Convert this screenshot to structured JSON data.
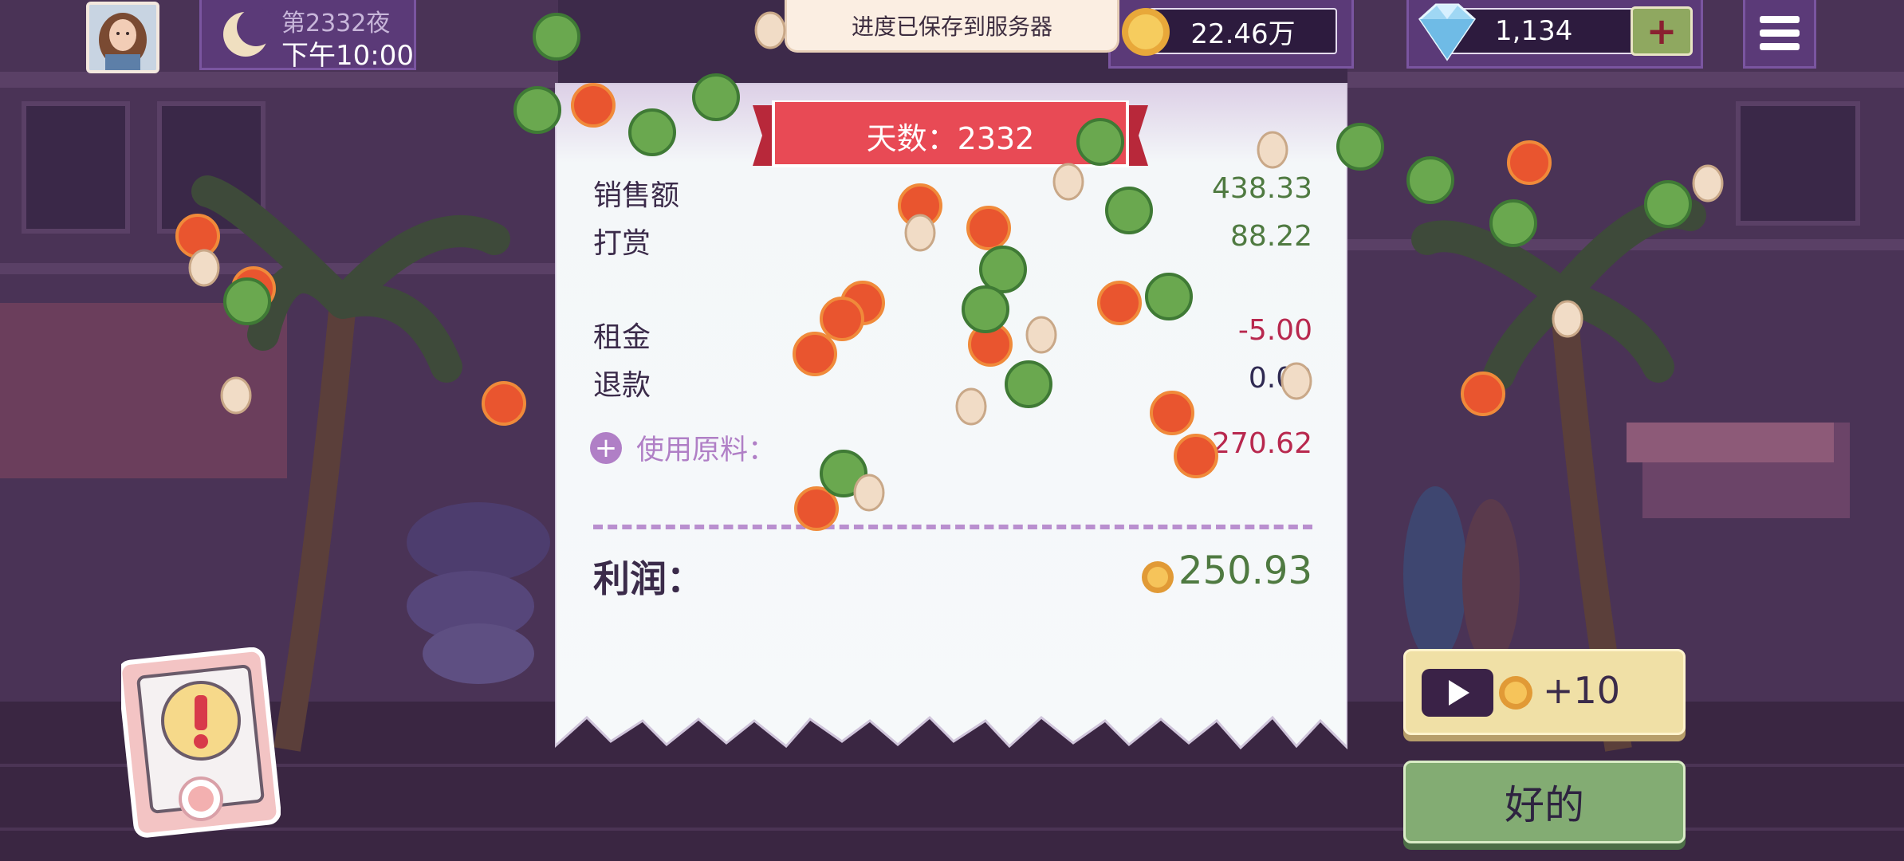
{
  "hud": {
    "day_label": "第2332夜",
    "time": "下午10:00",
    "toast": "进度已保存到服务器",
    "coins": "22.46万",
    "gems": "1,134",
    "gem_add_label": "+"
  },
  "receipt": {
    "banner": "天数：2332",
    "rows": [
      {
        "label": "销售额",
        "value": "438.33"
      },
      {
        "label": "打赏",
        "value": "88.22"
      },
      {
        "label": "租金",
        "value": "-5.00"
      },
      {
        "label": "退款",
        "value": "0.00"
      }
    ],
    "materials_label": "使用原料：",
    "materials_value": "-270.62",
    "profit_label": "利润：",
    "profit_value": "250.93"
  },
  "buttons": {
    "ad_reward": "+10",
    "ok": "好的"
  },
  "icons": {
    "time_of_day": "moon-icon",
    "currency": "coin-icon",
    "premium_currency": "diamond-icon",
    "menu": "hamburger-menu-icon",
    "alert": "exclamation-icon",
    "video_ad": "play-icon",
    "expand": "plus-circle-icon"
  },
  "colors": {
    "positive": "#4f7a41",
    "negative": "#b8284e",
    "banner": "#e84a55",
    "accent": "#b07fc6"
  }
}
